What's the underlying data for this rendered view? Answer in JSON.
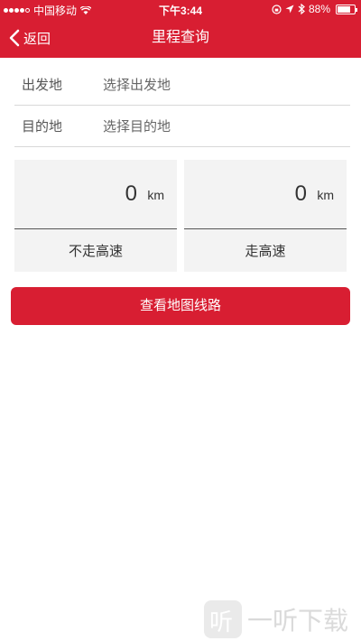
{
  "status_bar": {
    "carrier": "中国移动",
    "time": "下午3:44",
    "battery": "88%",
    "battery_level": 0.88
  },
  "nav": {
    "back_label": "返回",
    "title": "里程查询"
  },
  "form": {
    "origin_label": "出发地",
    "origin_placeholder": "选择出发地",
    "destination_label": "目的地",
    "destination_placeholder": "选择目的地"
  },
  "results": [
    {
      "value": "0",
      "unit": "km",
      "label": "不走高速"
    },
    {
      "value": "0",
      "unit": "km",
      "label": "走高速"
    }
  ],
  "actions": {
    "map_route_label": "查看地图线路"
  },
  "watermark": {
    "icon_text": "听",
    "text": "一听下载"
  },
  "colors": {
    "brand_red": "#d81e32",
    "card_bg": "#f3f3f3"
  }
}
